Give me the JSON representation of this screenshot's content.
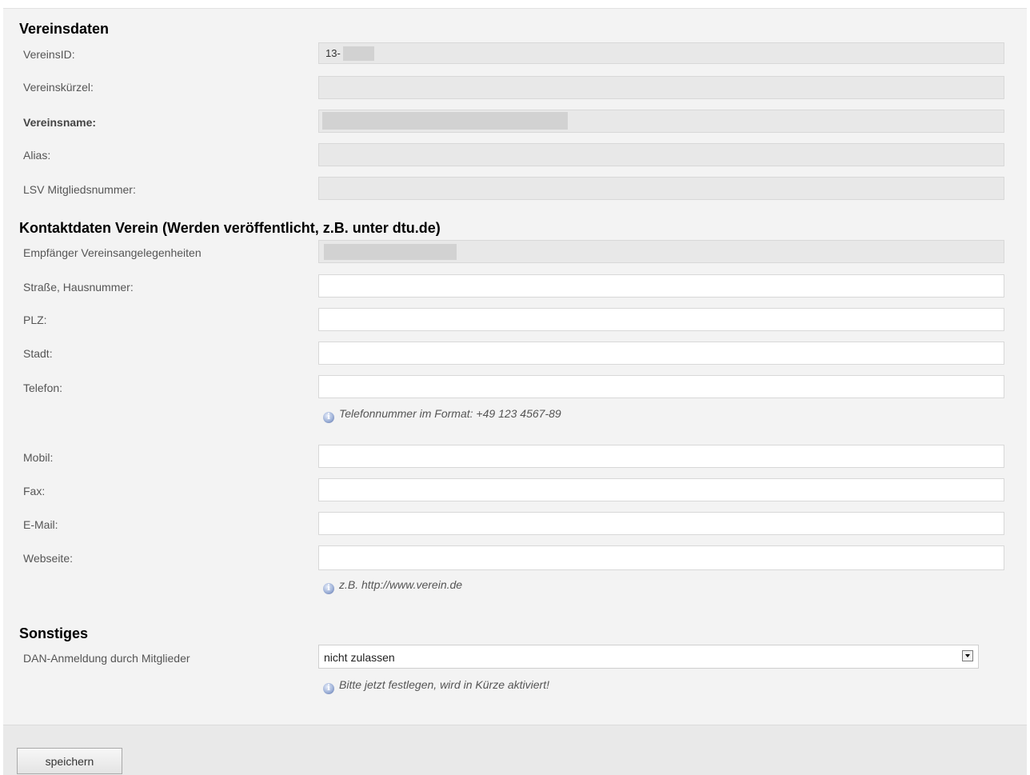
{
  "sections": {
    "vereinsdaten": {
      "title": "Vereinsdaten"
    },
    "kontakt": {
      "title": "Kontaktdaten Verein (Werden veröffentlicht, z.B. unter dtu.de)"
    },
    "sonstiges": {
      "title": "Sonstiges"
    }
  },
  "vereinsdaten": {
    "vereinsid_label": "VereinsID:",
    "vereinsid_value": "13-",
    "kuerzel_label": "Vereinskürzel:",
    "name_label": "Vereinsname:",
    "alias_label": "Alias:",
    "lsv_label": "LSV Mitgliedsnummer:"
  },
  "kontakt": {
    "empfaenger_label": "Empfänger Vereinsangelegenheiten",
    "strasse_label": "Straße, Hausnummer:",
    "plz_label": "PLZ:",
    "stadt_label": "Stadt:",
    "telefon_label": "Telefon:",
    "telefon_hint": "Telefonnummer im Format: +49 123 4567-89",
    "mobil_label": "Mobil:",
    "fax_label": "Fax:",
    "email_label": "E-Mail:",
    "webseite_label": "Webseite:",
    "webseite_hint": "z.B. http://www.verein.de"
  },
  "sonstiges": {
    "dan_label": "DAN-Anmeldung durch Mitglieder",
    "dan_selected": "nicht zulassen",
    "dan_hint": "Bitte jetzt festlegen, wird in Kürze aktiviert!"
  },
  "footer": {
    "save_label": "speichern"
  },
  "icons": {
    "info": "info-icon",
    "dropdown": "chevron-down-icon"
  },
  "colors": {
    "panel_bg": "#f3f3f3",
    "readonly_bg": "#e8e8e8",
    "redacted": "#d2d2d2"
  }
}
